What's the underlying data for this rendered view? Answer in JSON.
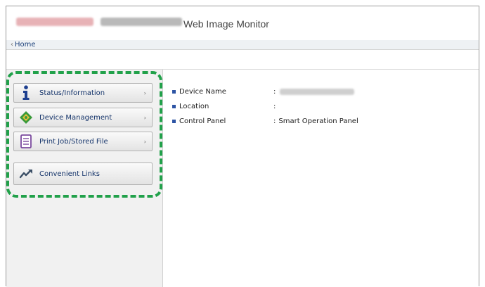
{
  "header": {
    "app_title": "Web Image Monitor"
  },
  "breadcrumb": {
    "chevron": "‹",
    "home_label": "Home"
  },
  "sidebar": {
    "items": [
      {
        "label": "Status/Information",
        "icon": "info-icon",
        "arrow": "›"
      },
      {
        "label": "Device Management",
        "icon": "device-management-icon",
        "arrow": "›"
      },
      {
        "label": "Print Job/Stored File",
        "icon": "print-job-icon",
        "arrow": "›"
      },
      {
        "label": "Convenient Links",
        "icon": "link-icon"
      }
    ]
  },
  "device_info": {
    "separator": ":",
    "rows": [
      {
        "key": "Device Name",
        "value": ""
      },
      {
        "key": "Location",
        "value": ""
      },
      {
        "key": "Control Panel",
        "value": "Smart Operation Panel"
      }
    ]
  },
  "colors": {
    "highlight": "#21a14a",
    "nav_text": "#16356b",
    "bullet": "#2d54a4"
  }
}
